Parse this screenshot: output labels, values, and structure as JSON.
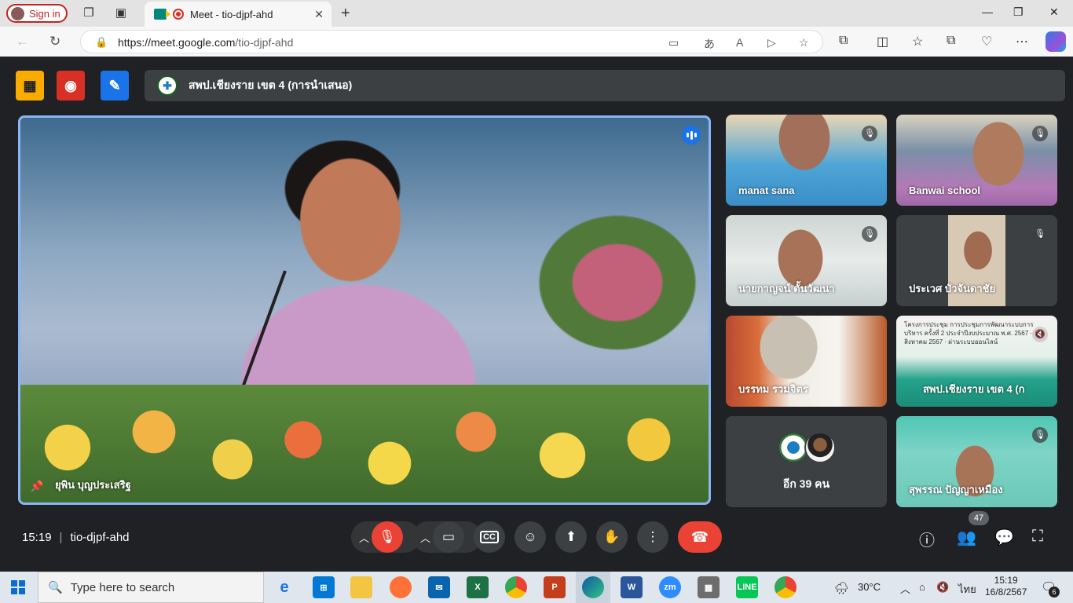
{
  "browser": {
    "signin_label": "Sign in",
    "tab_title": "Meet - tio-djpf-ahd",
    "url_host": "https://meet.google.com",
    "url_path": "/tio-djpf-ahd"
  },
  "meet": {
    "presentation_title": "สพป.เชียงราย เขต 4 (การนำเสนอ)",
    "main_speaker": "ยุพิน บุญประเสริฐ",
    "participants": [
      {
        "name": "manat sana"
      },
      {
        "name": "Banwai school"
      },
      {
        "name": "นายกาญจน์ ตั้นวัฒนา"
      },
      {
        "name": "ประเวศ บัวจันดาชัย"
      },
      {
        "name": "บรรทม รวมจิตร"
      },
      {
        "name": "สพป.เชียงราย เขต 4 (ก"
      },
      {
        "name": "สุพรรณ ปัญญาเหมือง"
      }
    ],
    "slide_text": "โครงการประชุม การประชุมการพัฒนาระบบการบริหาร ครั้งที่ 2 ประจำปีงบประมาณ พ.ศ. 2567 · 16 สิงหาคม 2567 · ผ่านระบบออนไลน์",
    "more_participants": "อีก 39 คน",
    "time": "15:19",
    "meeting_code": "tio-djpf-ahd",
    "people_count": "47"
  },
  "taskbar": {
    "search_placeholder": "Type here to search",
    "weather": "30°C",
    "lang": "ไทย",
    "time": "15:19",
    "date": "16/8/2567",
    "notifications": "6"
  },
  "colors": {
    "meet_bg": "#202124",
    "end_call": "#ea4335",
    "active_border": "#8ab4f8",
    "accent_yellow": "#f9ab00",
    "accent_red": "#d93025",
    "accent_blue": "#1a73e8"
  }
}
